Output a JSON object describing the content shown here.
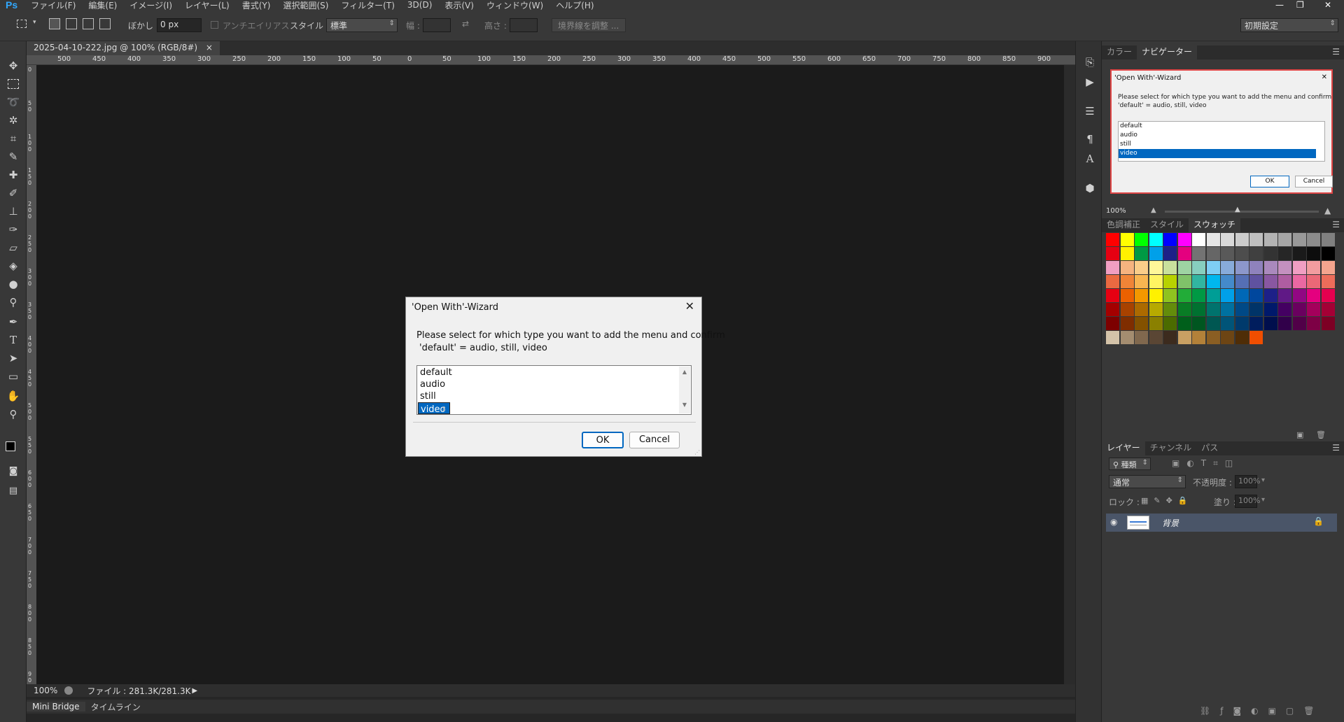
{
  "app": {
    "logo": "Ps",
    "title_window_controls": [
      "—",
      "❐",
      "✕"
    ]
  },
  "menu": [
    "ファイル(F)",
    "編集(E)",
    "イメージ(I)",
    "レイヤー(L)",
    "書式(Y)",
    "選択範囲(S)",
    "フィルター(T)",
    "3D(D)",
    "表示(V)",
    "ウィンドウ(W)",
    "ヘルプ(H)"
  ],
  "options": {
    "feather_label": "ぼかし :",
    "feather_value": "0 px",
    "antialias_label": "アンチエイリアス",
    "style_label": "スタイル :",
    "style_value": "標準",
    "width_label": "幅 :",
    "height_label": "高さ :",
    "refine_button": "境界線を調整 ...",
    "workspace": "初期設定"
  },
  "document": {
    "tab_title": "2025-04-10-222.jpg @ 100% (RGB/8#)",
    "close": "×",
    "ruler_h": [
      "500",
      "450",
      "400",
      "350",
      "300",
      "250",
      "200",
      "150",
      "100",
      "50",
      "0",
      "50",
      "100",
      "150",
      "200",
      "250",
      "300",
      "350",
      "400",
      "450",
      "500",
      "550",
      "600",
      "650",
      "700",
      "750",
      "800",
      "850",
      "900"
    ],
    "ruler_v": [
      "0",
      "50",
      "100",
      "150",
      "200",
      "250",
      "300",
      "350",
      "400",
      "450",
      "500",
      "550",
      "600",
      "650",
      "700",
      "750",
      "800",
      "850",
      "900"
    ],
    "status_zoom": "100%",
    "status_file": "ファイル : 281.3K/281.3K"
  },
  "bottom_tabs": [
    "Mini Bridge",
    "タイムライン"
  ],
  "panels": {
    "top_tabs": [
      "カラー",
      "ナビゲーター"
    ],
    "nav_zoom": "100%",
    "mid_tabs": [
      "色調補正",
      "スタイル",
      "スウォッチ"
    ],
    "layers_tabs": [
      "レイヤー",
      "チャンネル",
      "パス"
    ],
    "kind_label": "種類",
    "blend_mode": "通常",
    "opacity_label": "不透明度 :",
    "opacity_value": "100%",
    "lock_label": "ロック :",
    "fill_label": "塗り :",
    "fill_value": "100%",
    "layer_name": "背景"
  },
  "swatches": [
    [
      "#ff0000",
      "#ffff00",
      "#00ff00",
      "#00ffff",
      "#0000ff",
      "#ff00ff",
      "#ffffff",
      "#e6e6e6",
      "#d9d9d9",
      "#cccccc",
      "#bfbfbf",
      "#b3b3b3",
      "#a6a6a6",
      "#999999",
      "#8c8c8c",
      "#808080"
    ],
    [
      "#e60012",
      "#fff100",
      "#009944",
      "#00a0e9",
      "#1d2088",
      "#e4007f",
      "#737373",
      "#666666",
      "#595959",
      "#4d4d4d",
      "#404040",
      "#333333",
      "#262626",
      "#1a1a1a",
      "#0d0d0d",
      "#000000"
    ],
    [
      "#f19ec2",
      "#f6b37f",
      "#facd89",
      "#fff799",
      "#c9e09c",
      "#9ed3a3",
      "#87cfbf",
      "#7ecef4",
      "#88abda",
      "#8c97cb",
      "#8f82bc",
      "#aa89bd",
      "#c490bf",
      "#f09ec2",
      "#f29c9f",
      "#f4a48e"
    ],
    [
      "#ea6941",
      "#f08437",
      "#f8b551",
      "#fff462",
      "#b8d200",
      "#80c269",
      "#31b5a1",
      "#00b7ee",
      "#448aca",
      "#556fb5",
      "#5f52a0",
      "#8957a1",
      "#ae5da1",
      "#ea68a2",
      "#eb6877",
      "#ec6c5a"
    ],
    [
      "#e60012",
      "#eb6100",
      "#f39800",
      "#fff100",
      "#8fc31f",
      "#22ac38",
      "#009944",
      "#009e96",
      "#00a0e9",
      "#0068b7",
      "#00479d",
      "#1d2088",
      "#601986",
      "#920783",
      "#e4007f",
      "#e5004f"
    ],
    [
      "#a40000",
      "#a84200",
      "#ac6a00",
      "#b7aa00",
      "#638c0b",
      "#097c25",
      "#007130",
      "#00736d",
      "#0071a0",
      "#004986",
      "#003468",
      "#00196b",
      "#440062",
      "#6a005f",
      "#a4005b",
      "#a40035"
    ],
    [
      "#7d0000",
      "#7f2d00",
      "#835100",
      "#8a8000",
      "#4b6b00",
      "#005f1b",
      "#005620",
      "#005752",
      "#005478",
      "#003a6c",
      "#001d5d",
      "#000f4d",
      "#31004a",
      "#510048",
      "#7d0045",
      "#7d0024"
    ],
    [
      "#d4c3a9",
      "#a48d70",
      "#80684e",
      "#5a4634",
      "#3c2b1e",
      "#c9a063",
      "#b38139",
      "#8a5e23",
      "#6d4514",
      "#4f2d07",
      "#f04e00"
    ]
  ],
  "dialog": {
    "title": "'Open With'-Wizard",
    "close": "✕",
    "message_line1": "Please select for which type you want to add the menu and confirm",
    "message_line2": "'default' = audio, still, video",
    "items": [
      "default",
      "audio",
      "still",
      "video"
    ],
    "selected": "video",
    "ok": "OK",
    "cancel": "Cancel"
  }
}
